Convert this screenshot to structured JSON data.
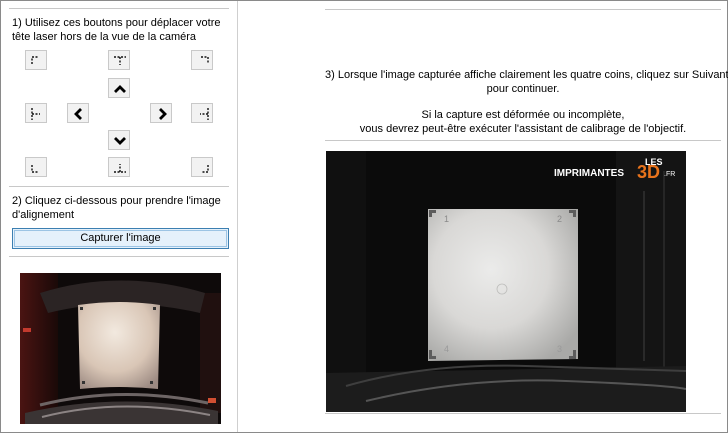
{
  "step1": {
    "line1": "1) Utilisez ces boutons pour déplacer votre",
    "line2": "tête laser hors de la vue de la caméra"
  },
  "jog_buttons": [
    {
      "name": "jog-top-left-button",
      "icon": "corner-top-left-icon"
    },
    {
      "name": "jog-top-center-button",
      "icon": "edge-top-icon"
    },
    {
      "name": "jog-top-right-button",
      "icon": "corner-top-right-icon"
    },
    {
      "name": "jog-up-button",
      "icon": "chevron-up-icon"
    },
    {
      "name": "jog-left-edge-button",
      "icon": "edge-left-icon"
    },
    {
      "name": "jog-left-button",
      "icon": "chevron-left-icon"
    },
    {
      "name": "jog-right-button",
      "icon": "chevron-right-icon"
    },
    {
      "name": "jog-right-edge-button",
      "icon": "edge-right-icon"
    },
    {
      "name": "jog-down-button",
      "icon": "chevron-down-icon"
    },
    {
      "name": "jog-bottom-left-button",
      "icon": "corner-bottom-left-icon"
    },
    {
      "name": "jog-bottom-center-button",
      "icon": "edge-bottom-icon"
    },
    {
      "name": "jog-bottom-right-button",
      "icon": "corner-bottom-right-icon"
    }
  ],
  "step2": {
    "line1": "2) Cliquez ci-dessous pour prendre l'image",
    "line2": "d'alignement",
    "button_label": "Capturer l'image"
  },
  "step3": {
    "line1": "3) Lorsque l'image capturée affiche clairement les quatre coins, cliquez sur Suivant",
    "line2": "pour continuer.",
    "line3": "Si la capture est déformée ou incomplète,",
    "line4": "vous devrez peut-être exécuter l'assistant de calibrage de l'objectif."
  },
  "watermark": {
    "les": "LES",
    "imprimantes": "IMPRIMANTES",
    "three_d": "3D",
    "fr": ".FR"
  },
  "bed_markers": [
    "1",
    "2",
    "3",
    "4"
  ],
  "colors": {
    "accent_border": "#3c7fb1",
    "button_face": "#e5f1fb",
    "watermark_orange": "#e8731c"
  }
}
